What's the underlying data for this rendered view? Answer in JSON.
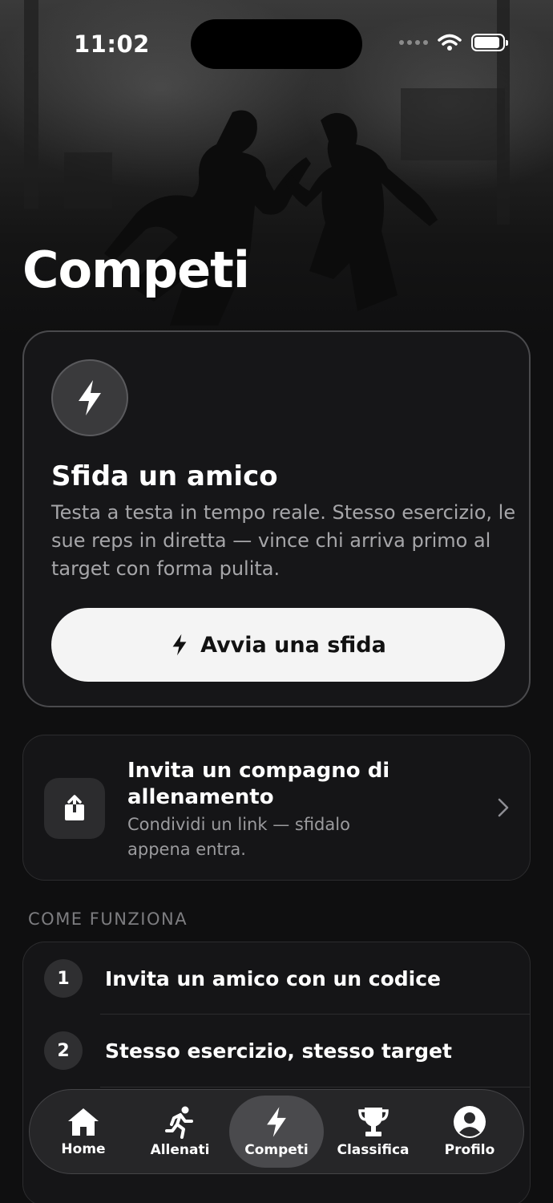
{
  "status_bar": {
    "time": "11:02",
    "battery_level": 0.9
  },
  "page": {
    "title": "Competi"
  },
  "challenge_card": {
    "icon": "bolt-icon",
    "title": "Sfida un amico",
    "description": "Testa a testa in tempo reale. Stesso esercizio, le sue reps in diretta — vince chi arriva primo al target con forma pulita.",
    "button_label": "Avvia una sfida"
  },
  "invite": {
    "icon": "share-icon",
    "title": "Invita un compagno di allenamento",
    "subtitle": "Condividi un link — sfidalo appena entra."
  },
  "how_it_works": {
    "section_label": "COME FUNZIONA",
    "steps": [
      {
        "number": "1",
        "text": "Invita un amico con un codice"
      },
      {
        "number": "2",
        "text": "Stesso esercizio, stesso target"
      }
    ]
  },
  "tab_bar": {
    "tabs": [
      {
        "label": "Home",
        "icon": "home-icon"
      },
      {
        "label": "Allenati",
        "icon": "runner-icon"
      },
      {
        "label": "Competi",
        "icon": "bolt-icon",
        "active": true
      },
      {
        "label": "Classifica",
        "icon": "trophy-icon"
      },
      {
        "label": "Profilo",
        "icon": "profile-icon"
      }
    ]
  }
}
